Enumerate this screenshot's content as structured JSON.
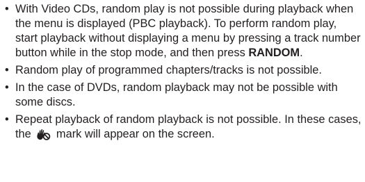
{
  "notes": {
    "bullet": "•",
    "item1": {
      "text_before": "With Video CDs, random play is not possible during playback when the menu is displayed (PBC playback). To perform random play, start playback without displaying a menu by pressing a track number button while in the stop mode, and then press ",
      "button_name": "RANDOM",
      "text_after": "."
    },
    "item2": {
      "text": "Random play of programmed chapters/tracks is not possible."
    },
    "item3": {
      "text": "In the case of DVDs, random playback may not be possible with some discs."
    },
    "item4": {
      "text_before": "Repeat playback of random playback is not possible. In these cases, the",
      "mark_icon": "prohibit-hand-icon",
      "text_after": "mark will appear on the screen."
    }
  }
}
